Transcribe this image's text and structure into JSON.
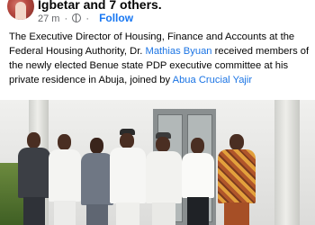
{
  "header": {
    "names_text": "Igbetar and 7 others.",
    "time": "27 m",
    "dot": "·",
    "follow_label": "Follow"
  },
  "post": {
    "text_part1": "The Executive Director of Housing, Finance and Accounts at the Federal Housing Authority, Dr. ",
    "mention1": "Mathias Byuan",
    "text_part2": " received members of the newly elected Benue state PDP executive committee at his private residence in Abuja, joined by ",
    "mention2": "Abua Crucial Yajir"
  },
  "colors": {
    "link": "#1b74e4",
    "follow": "#1877f2",
    "meta": "#65676b"
  },
  "icons": {
    "privacy": "globe-icon"
  }
}
